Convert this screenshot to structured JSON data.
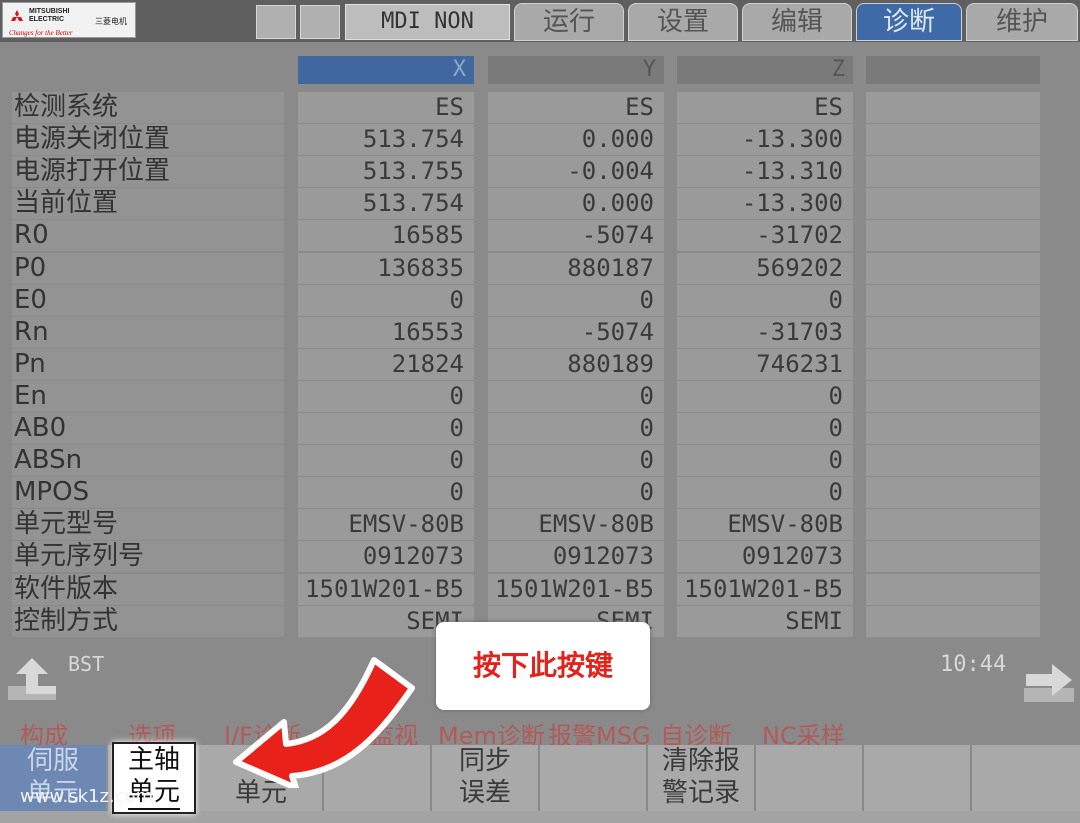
{
  "header": {
    "logo": {
      "brand_line1": "MITSUBISHI",
      "brand_line2": "ELECTRIC",
      "brand_cn": "三菱电机",
      "tagline": "Changes for the Better"
    },
    "mode": "MDI NON",
    "tabs": [
      {
        "label": "运行",
        "active": false
      },
      {
        "label": "设置",
        "active": false
      },
      {
        "label": "编辑",
        "active": false
      },
      {
        "label": "诊断",
        "active": true
      },
      {
        "label": "维护",
        "active": false
      }
    ]
  },
  "table": {
    "columns": [
      "X",
      "Y",
      "Z",
      ""
    ],
    "rows": [
      {
        "label": "检测系统",
        "values": [
          "ES",
          "ES",
          "ES",
          ""
        ]
      },
      {
        "label": "电源关闭位置",
        "values": [
          "513.754",
          "0.000",
          "-13.300",
          ""
        ]
      },
      {
        "label": "电源打开位置",
        "values": [
          "513.755",
          "-0.004",
          "-13.310",
          ""
        ]
      },
      {
        "label": "当前位置",
        "values": [
          "513.754",
          "0.000",
          "-13.300",
          ""
        ]
      },
      {
        "label": "R0",
        "values": [
          "16585",
          "-5074",
          "-31702",
          ""
        ]
      },
      {
        "label": "P0",
        "values": [
          "136835",
          "880187",
          "569202",
          ""
        ]
      },
      {
        "label": "E0",
        "values": [
          "0",
          "0",
          "0",
          ""
        ]
      },
      {
        "label": "Rn",
        "values": [
          "16553",
          "-5074",
          "-31703",
          ""
        ]
      },
      {
        "label": "Pn",
        "values": [
          "21824",
          "880189",
          "746231",
          ""
        ]
      },
      {
        "label": "En",
        "values": [
          "0",
          "0",
          "0",
          ""
        ]
      },
      {
        "label": "AB0",
        "values": [
          "0",
          "0",
          "0",
          ""
        ]
      },
      {
        "label": "ABSn",
        "values": [
          "0",
          "0",
          "0",
          ""
        ]
      },
      {
        "label": "MPOS",
        "values": [
          "0",
          "0",
          "0",
          ""
        ]
      },
      {
        "label": "单元型号",
        "values": [
          "EMSV-80B",
          "EMSV-80B",
          "EMSV-80B",
          ""
        ]
      },
      {
        "label": "单元序列号",
        "values": [
          "0912073",
          "0912073",
          "0912073",
          ""
        ]
      },
      {
        "label": "软件版本",
        "values": [
          "1501W201-B5",
          "1501W201-B5",
          "1501W201-B5",
          ""
        ]
      },
      {
        "label": "控制方式",
        "values": [
          "SEMI",
          "SEMI",
          "SEMI",
          ""
        ]
      }
    ]
  },
  "status": {
    "bst": "BST",
    "time": "10:44"
  },
  "menu": [
    "构成",
    "选项",
    "I/F诊断",
    "监视",
    "Mem诊断",
    "报警MSG",
    "自诊断",
    "NC采样"
  ],
  "softkeys": [
    {
      "line1": "伺服",
      "line2": "单元"
    },
    {
      "line1": "主轴",
      "line2": "单元"
    },
    {
      "line1": "",
      "line2": "单元"
    },
    {
      "line1": "",
      "line2": ""
    },
    {
      "line1": "同步",
      "line2": "误差"
    },
    {
      "line1": "",
      "line2": ""
    },
    {
      "line1": "清除报",
      "line2": "警记录"
    },
    {
      "line1": "",
      "line2": ""
    },
    {
      "line1": "",
      "line2": ""
    },
    {
      "line1": "",
      "line2": ""
    }
  ],
  "callout": "按下此按键",
  "watermark": "www.sk1z.com",
  "colors": {
    "accent": "#3e6aa8",
    "callout_text": "#e0231b",
    "arrow": "#e8211a"
  }
}
